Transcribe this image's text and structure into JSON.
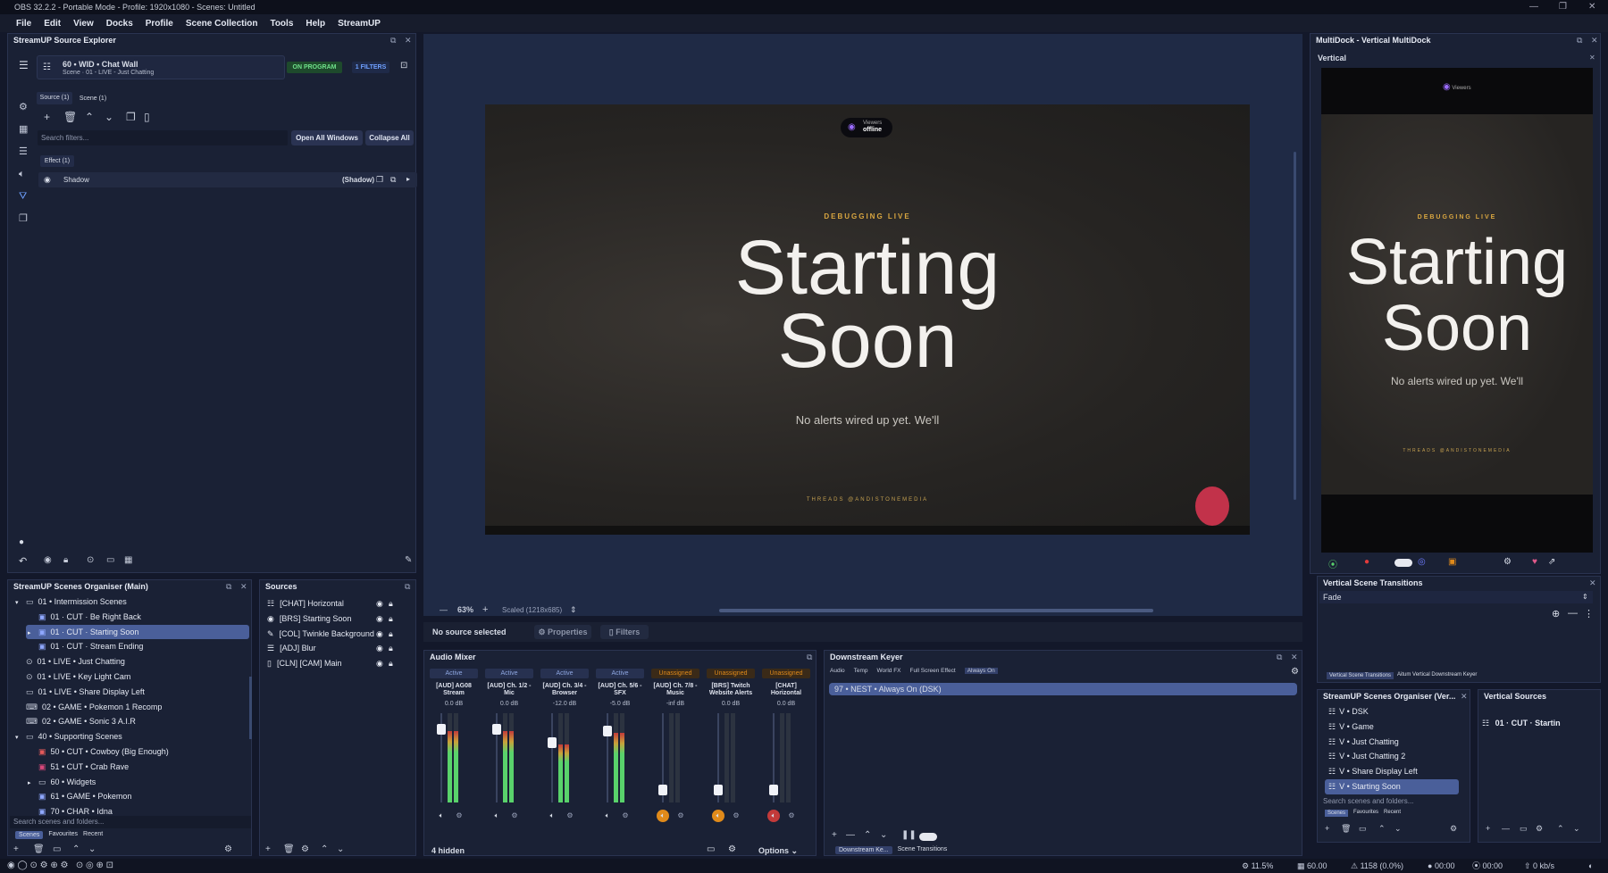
{
  "window": {
    "title": "OBS 32.2.2 - Portable Mode - Profile: 1920x1080 - Scenes: Untitled"
  },
  "menu": [
    "File",
    "Edit",
    "View",
    "Docks",
    "Profile",
    "Scene Collection",
    "Tools",
    "Help",
    "StreamUP"
  ],
  "source_explorer": {
    "title": "StreamUP Source Explorer",
    "source_name": "60 • WID • Chat Wall",
    "source_sub": "Scene · 01 - LIVE - Just Chatting",
    "on_program": "ON PROGRAM",
    "filters_badge": "1 FILTERS",
    "tabs": [
      "Source (1)",
      "Scene (1)"
    ],
    "search_placeholder": "Search filters...",
    "open_all": "Open All Windows",
    "collapse_all": "Collapse All",
    "effect_tab": "Effect (1)",
    "filter_name": "Shadow",
    "filter_type": "(Shadow)"
  },
  "preview": {
    "viewers_label": "Viewers",
    "viewers_status": "offline",
    "debugging": "DEBUGGING LIVE",
    "starting": "Starting",
    "soon": "Soon",
    "no_alerts": "No alerts wired up yet. We'll",
    "threads": "THREADS  @ANDISTONEMEDIA",
    "zoom": "63%",
    "scaled": "Scaled (1218x685)"
  },
  "controls": {
    "no_source": "No source selected",
    "properties": "Properties",
    "filters": "Filters"
  },
  "scenes_organiser": {
    "title": "StreamUP Scenes Organiser (Main)",
    "items": [
      {
        "label": "01 • Intermission Scenes",
        "type": "folder",
        "indent": 0
      },
      {
        "label": "01 · CUT · Be Right Back",
        "type": "scene",
        "indent": 1
      },
      {
        "label": "01 · CUT · Starting Soon",
        "type": "scene",
        "indent": 1,
        "selected": true
      },
      {
        "label": "01 · CUT · Stream Ending",
        "type": "scene",
        "indent": 1
      },
      {
        "label": "01 • LIVE • Just Chatting",
        "type": "cam",
        "indent": 0
      },
      {
        "label": "01 • LIVE • Key Light Cam",
        "type": "cam",
        "indent": 0
      },
      {
        "label": "01 • LIVE • Share Display Left",
        "type": "display",
        "indent": 0
      },
      {
        "label": "02 • GAME • Pokemon 1 Recomp",
        "type": "game",
        "indent": 0
      },
      {
        "label": "02 • GAME • Sonic 3 A.I.R",
        "type": "game",
        "indent": 0
      },
      {
        "label": "40 • Supporting Scenes",
        "type": "folder",
        "indent": 0
      },
      {
        "label": "50 • CUT • Cowboy (Big Enough)",
        "type": "red",
        "indent": 1
      },
      {
        "label": "51 • CUT • Crab Rave",
        "type": "pink",
        "indent": 1
      },
      {
        "label": "60 • Widgets",
        "type": "folder",
        "indent": 1
      },
      {
        "label": "61 • GAME • Pokemon",
        "type": "scene",
        "indent": 1
      },
      {
        "label": "70 • CHAR • Idna",
        "type": "scene",
        "indent": 1
      }
    ],
    "search_placeholder": "Search scenes and folders...",
    "tabs": [
      "Scenes",
      "Favourites",
      "Recent"
    ]
  },
  "sources": {
    "title": "Sources",
    "items": [
      "[CHAT] Horizontal",
      "[BRS] Starting Soon",
      "[COL] Twinkle Background",
      "[ADJ] Blur",
      "[CLN] [CAM] Main"
    ]
  },
  "audio_mixer": {
    "title": "Audio Mixer",
    "hidden": "4 hidden",
    "options": "Options",
    "channels": [
      {
        "status": "Active",
        "name": "[AUD] AG08 Stream",
        "db": "0.0 dB",
        "level": 0.8,
        "muted": false
      },
      {
        "status": "Active",
        "name": "[AUD] Ch. 1/2 - Mic",
        "db": "0.0 dB",
        "level": 0.8,
        "muted": false
      },
      {
        "status": "Active",
        "name": "[AUD] Ch. 3/4 - Browser",
        "db": "-12.0 dB",
        "level": 0.65,
        "muted": false
      },
      {
        "status": "Active",
        "name": "[AUD] Ch. 5/6 - SFX",
        "db": "-5.0 dB",
        "level": 0.78,
        "muted": false
      },
      {
        "status": "Unassigned",
        "name": "[AUD] Ch. 7/8 - Music",
        "db": "-inf dB",
        "level": 0.0,
        "muted": false
      },
      {
        "status": "Unassigned",
        "name": "[BRS] Twitch Website Alerts",
        "db": "0.0 dB",
        "level": 0.0,
        "muted": false
      },
      {
        "status": "Unassigned",
        "name": "[CHAT] Horizontal",
        "db": "0.0 dB",
        "level": 0.0,
        "muted": true
      }
    ]
  },
  "downstream_keyer": {
    "title": "Downstream Keyer",
    "tabs": [
      "Audio",
      "Temp",
      "World FX",
      "Full Screen Effect",
      "Always On"
    ],
    "item": "97 • NEST • Always On (DSK)",
    "bottom_tabs": [
      "Downstream Ke...",
      "Scene Transitions"
    ]
  },
  "multidock": {
    "title": "MultiDock - Vertical MultiDock",
    "vertical": "Vertical"
  },
  "vertical_transitions": {
    "title": "Vertical Scene Transitions",
    "value": "Fade",
    "tabs": [
      "Vertical Scene Transitions",
      "Aitum Vertical Downstream Keyer"
    ]
  },
  "vertical_organiser": {
    "title": "StreamUP Scenes Organiser (Ver...",
    "items": [
      "V • DSK",
      "V • Game",
      "V • Just Chatting",
      "V • Just Chatting 2",
      "V • Share Display Left",
      "V • Starting Soon"
    ],
    "search_placeholder": "Search scenes and folders...",
    "tabs": [
      "Scenes",
      "Favourites",
      "Recent"
    ]
  },
  "vertical_sources": {
    "title": "Vertical Sources",
    "item": "01 · CUT · Startin"
  },
  "status": {
    "cpu": "11.5%",
    "fps": "60.00",
    "frames": "1158 (0.0%)",
    "rec": "00:00",
    "stream": "00:00",
    "bitrate": "0 kb/s"
  },
  "colors": {
    "accent": "#4a5f9a",
    "orange": "#e08a1a",
    "green": "#59d26b"
  }
}
